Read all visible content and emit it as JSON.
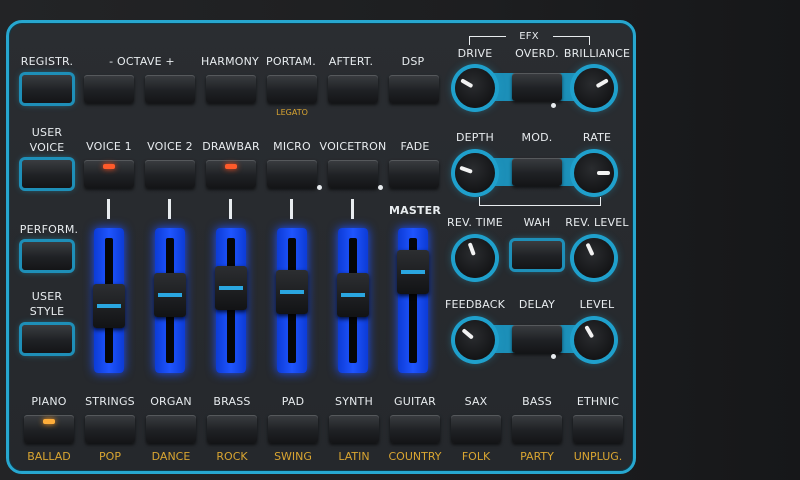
{
  "top_row": [
    {
      "id": "registr",
      "label": "REGISTR."
    },
    {
      "id": "octave",
      "label": "- OCTAVE +"
    },
    {
      "id": "harmony",
      "label": "HARMONY"
    },
    {
      "id": "portam",
      "label": "PORTAM.",
      "sub": "LEGATO"
    },
    {
      "id": "aftert",
      "label": "AFTERT."
    },
    {
      "id": "dsp",
      "label": "DSP"
    }
  ],
  "second_row": [
    {
      "id": "user-voice",
      "label": "USER VOICE"
    },
    {
      "id": "voice1",
      "label": "VOICE 1"
    },
    {
      "id": "voice2",
      "label": "VOICE 2"
    },
    {
      "id": "drawbar",
      "label": "DRAWBAR"
    },
    {
      "id": "micro",
      "label": "MICRO"
    },
    {
      "id": "voicetron",
      "label": "VOICETRON"
    },
    {
      "id": "fade",
      "label": "FADE"
    }
  ],
  "left_column": [
    {
      "id": "perform",
      "label": "PERFORM."
    },
    {
      "id": "user-style",
      "label": "USER STYLE"
    }
  ],
  "master_label": "MASTER",
  "faders": [
    {
      "id": "fader-1",
      "level": 0.45
    },
    {
      "id": "fader-2",
      "level": 0.55
    },
    {
      "id": "fader-3",
      "level": 0.62
    },
    {
      "id": "fader-4",
      "level": 0.58
    },
    {
      "id": "fader-5",
      "level": 0.55
    },
    {
      "id": "fader-master",
      "level": 0.78
    }
  ],
  "efx": {
    "title": "EFX",
    "row1": {
      "left": "DRIVE",
      "mid": "OVERD.",
      "right": "BRILLIANCE"
    },
    "row2": {
      "left": "DEPTH",
      "mid": "MOD.",
      "right": "RATE"
    },
    "row3": {
      "left": "REV. TIME",
      "mid": "WAH",
      "right": "REV. LEVEL"
    },
    "row4": {
      "left": "FEEDBACK",
      "mid": "DELAY",
      "right": "LEVEL"
    }
  },
  "styles": [
    {
      "id": "piano",
      "top": "PIANO",
      "bottom": "BALLAD"
    },
    {
      "id": "strings",
      "top": "STRINGS",
      "bottom": "POP"
    },
    {
      "id": "organ",
      "top": "ORGAN",
      "bottom": "DANCE"
    },
    {
      "id": "brass",
      "top": "BRASS",
      "bottom": "ROCK"
    },
    {
      "id": "pad",
      "top": "PAD",
      "bottom": "SWING"
    },
    {
      "id": "synth",
      "top": "SYNTH",
      "bottom": "LATIN"
    },
    {
      "id": "guitar",
      "top": "GUITAR",
      "bottom": "COUNTRY"
    },
    {
      "id": "sax",
      "top": "SAX",
      "bottom": "FOLK"
    },
    {
      "id": "bass",
      "top": "BASS",
      "bottom": "PARTY"
    },
    {
      "id": "ethnic",
      "top": "ETHNIC",
      "bottom": "UNPLUG."
    }
  ],
  "colors": {
    "accent": "#27a7cf",
    "led_red": "#ff5a2a",
    "led_amber": "#ffae3a",
    "sub_label": "#d9a531",
    "fader_blue": "#1f55ff"
  }
}
